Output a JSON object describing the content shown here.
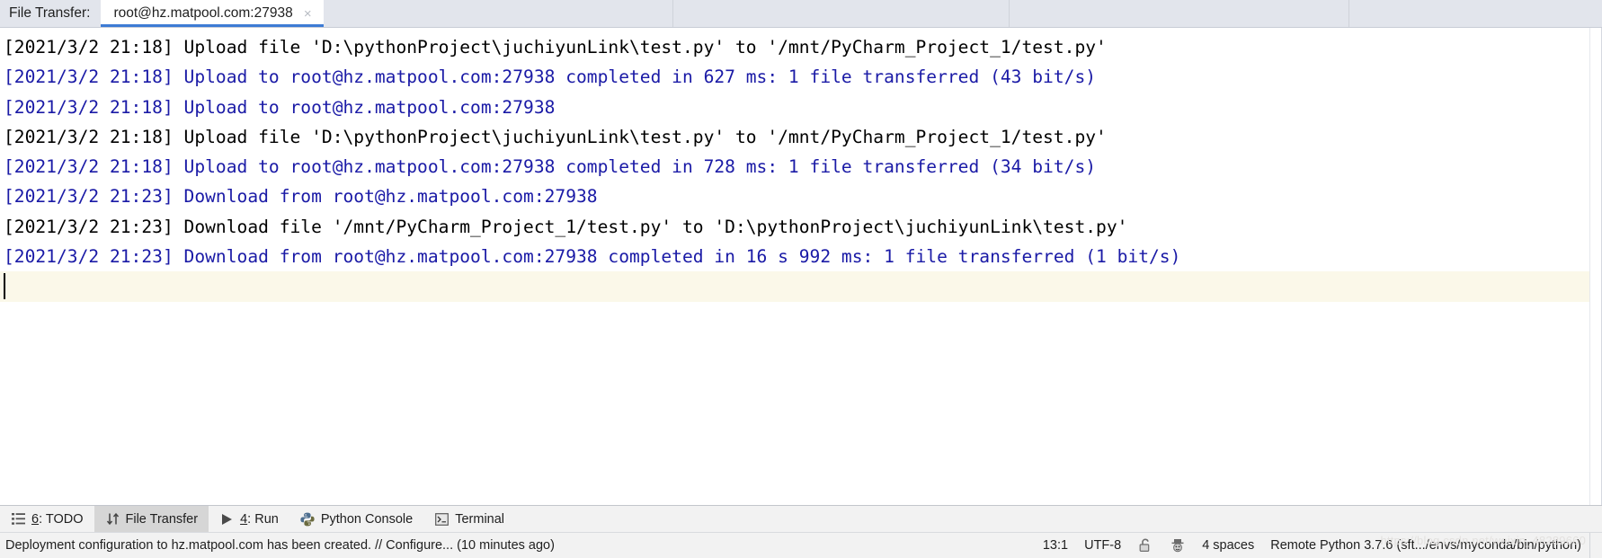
{
  "tabbar": {
    "label": "File Transfer:",
    "tabs": [
      {
        "title": "root@hz.matpool.com:27938",
        "close_glyph": "×",
        "active": true
      }
    ],
    "divider_positions": [
      748,
      1122,
      1500
    ]
  },
  "console": {
    "lines": [
      {
        "text": "[2021/3/2 21:18] Upload file 'D:\\pythonProject\\juchiyunLink\\test.py' to '/mnt/PyCharm_Project_1/test.py'",
        "color": "black"
      },
      {
        "text": "[2021/3/2 21:18] Upload to root@hz.matpool.com:27938 completed in 627 ms: 1 file transferred (43 bit/s)",
        "color": "blue"
      },
      {
        "text": "[2021/3/2 21:18] Upload to root@hz.matpool.com:27938",
        "color": "blue"
      },
      {
        "text": "[2021/3/2 21:18] Upload file 'D:\\pythonProject\\juchiyunLink\\test.py' to '/mnt/PyCharm_Project_1/test.py'",
        "color": "black"
      },
      {
        "text": "[2021/3/2 21:18] Upload to root@hz.matpool.com:27938 completed in 728 ms: 1 file transferred (34 bit/s)",
        "color": "blue"
      },
      {
        "text": "[2021/3/2 21:23] Download from root@hz.matpool.com:27938",
        "color": "blue"
      },
      {
        "text": "[2021/3/2 21:23] Download file '/mnt/PyCharm_Project_1/test.py' to 'D:\\pythonProject\\juchiyunLink\\test.py'",
        "color": "black"
      },
      {
        "text": "[2021/3/2 21:23] Download from root@hz.matpool.com:27938 completed in 16 s 992 ms: 1 file transferred (1 bit/s)",
        "color": "blue"
      }
    ],
    "text_color_black": "#000000",
    "text_color_blue": "#1a1aa6",
    "caret_line_background": "#fbf8e9"
  },
  "toolwindow_bar": {
    "buttons": [
      {
        "icon": "list-icon",
        "prefix": "6",
        "label": ": TODO",
        "active": false
      },
      {
        "icon": "transfer-icon",
        "prefix": "",
        "label": "File Transfer",
        "active": true
      },
      {
        "icon": "run-icon",
        "prefix": "4",
        "label": ": Run",
        "active": false
      },
      {
        "icon": "python-icon",
        "prefix": "",
        "label": "Python Console",
        "active": false
      },
      {
        "icon": "terminal-icon",
        "prefix": "",
        "label": "Terminal",
        "active": false
      }
    ]
  },
  "statusbar": {
    "message": "Deployment configuration to hz.matpool.com has been created. // Configure... (10 minutes ago)",
    "caret_position": "13:1",
    "encoding": "UTF-8",
    "lock_icon": "unlocked-padlock-icon",
    "guest_icon": "hat-face-icon",
    "indent": "4 spaces",
    "interpreter": "Remote Python 3.7.6 (sft.../envs/myconda/bin/python)",
    "watermark": "https://blog.csdn.net/weixin_48289660"
  },
  "colors": {
    "tab_bar_background": "#e2e5ec",
    "active_tab_underline": "#3d7bd4",
    "toolbar_background": "#f2f2f2",
    "active_toolwindow_background": "#d6d6d6",
    "console_background": "#ffffff"
  }
}
